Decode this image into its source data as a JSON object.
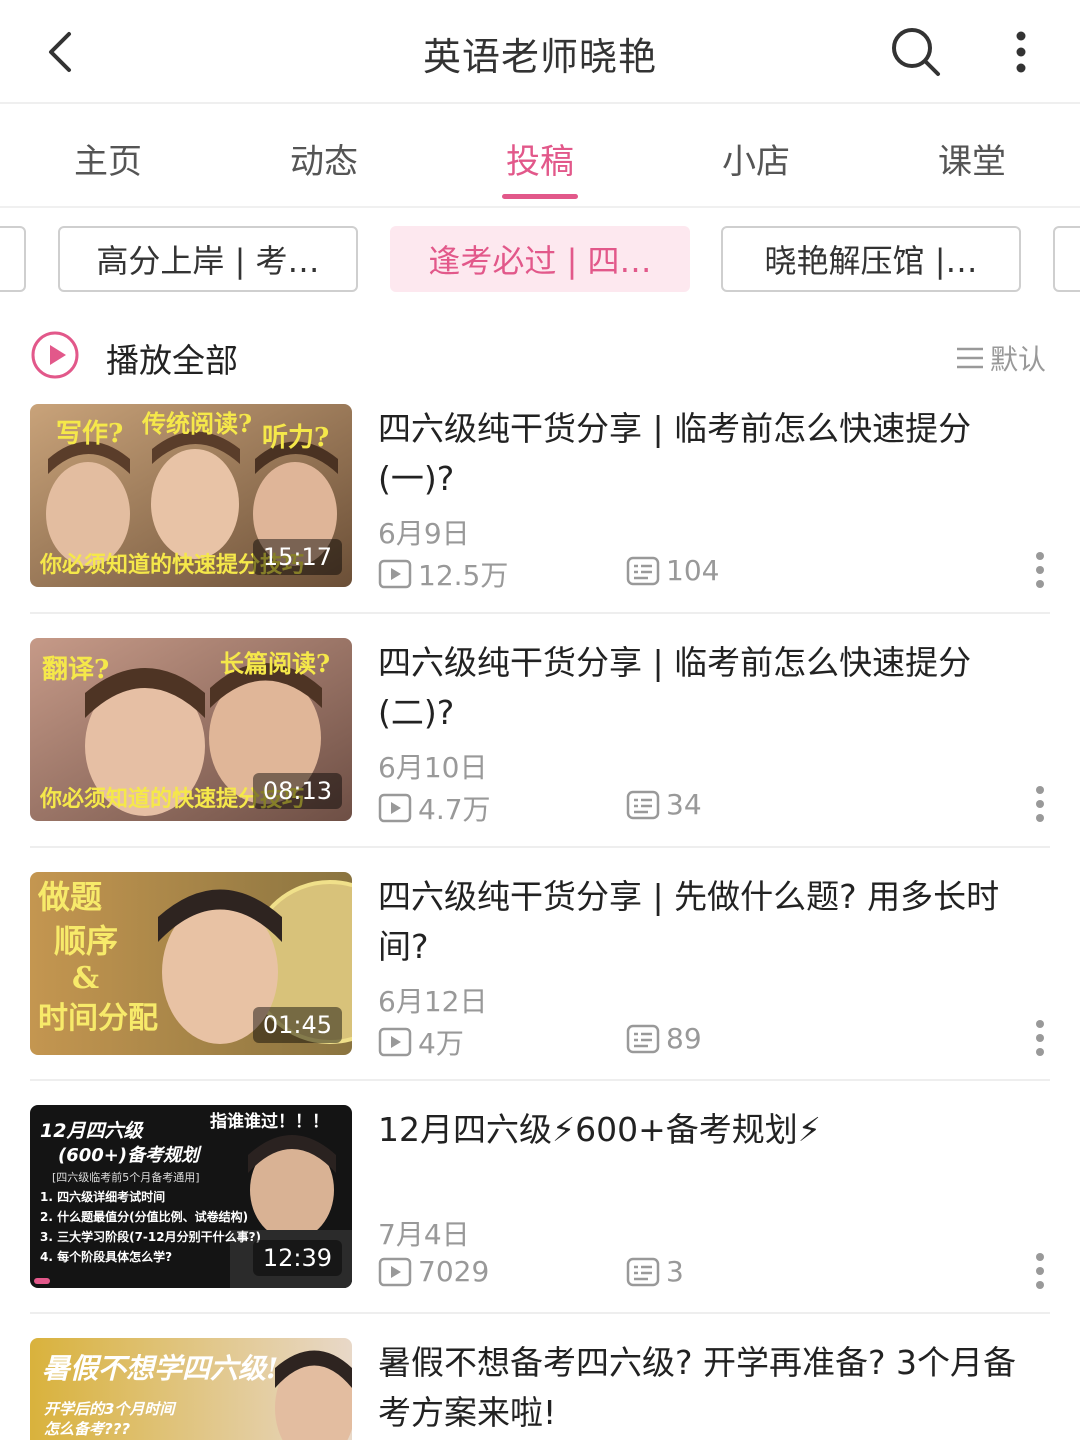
{
  "header": {
    "title": "英语老师晓艳",
    "icons": [
      "back-arrow-icon",
      "search-icon",
      "more-vertical-icon"
    ]
  },
  "tabs": [
    {
      "label": "主页",
      "active": false
    },
    {
      "label": "动态",
      "active": false
    },
    {
      "label": "投稿",
      "active": true
    },
    {
      "label": "小店",
      "active": false
    },
    {
      "label": "课堂",
      "active": false
    }
  ],
  "collections": [
    {
      "label": "高分上岸 | 考…",
      "active": false
    },
    {
      "label": "逢考必过 | 四…",
      "active": true
    },
    {
      "label": "晓艳解压馆 |…",
      "active": false
    }
  ],
  "play_all": {
    "label": "播放全部",
    "sort_label": "默认"
  },
  "colors": {
    "accent": "#e2588a",
    "accent_bg": "#fde8ef",
    "muted": "#999999"
  },
  "videos": [
    {
      "title": "四六级纯干货分享 | 临考前怎么快速提分(一)?",
      "date": "6月9日",
      "views": "12.5万",
      "comments": "104",
      "duration": "15:17",
      "thumb": {
        "bg": [
          "#c9a37a",
          "#8c6b4b"
        ],
        "caption": "你必须知道的快速提分技巧",
        "tags": [
          "写作?",
          "传统阅读?",
          "听力?"
        ]
      }
    },
    {
      "title": "四六级纯干货分享 | 临考前怎么快速提分(二)?",
      "date": "6月10日",
      "views": "4.7万",
      "comments": "34",
      "duration": "08:13",
      "thumb": {
        "bg": [
          "#c69a88",
          "#7a5a4e"
        ],
        "caption": "你必须知道的快速提分技巧",
        "tags": [
          "翻译?",
          "长篇阅读?"
        ]
      }
    },
    {
      "title": "四六级纯干货分享 | 先做什么题? 用多长时间?",
      "date": "6月12日",
      "views": "4万",
      "comments": "89",
      "duration": "01:45",
      "thumb": {
        "bg": [
          "#b88a4a",
          "#6a5a3a"
        ],
        "caption": "",
        "tags": [
          "做题",
          "顺序",
          "&",
          "时间分配"
        ]
      }
    },
    {
      "title": "12月四六级⚡600+备考规划⚡",
      "date": "7月4日",
      "views": "7029",
      "comments": "3",
      "duration": "12:39",
      "thumb": {
        "bg": [
          "#111111",
          "#222222"
        ],
        "caption": "",
        "tags": [
          "12月四六级",
          "(600+)备考规划",
          "指谁谁过！！！"
        ]
      }
    },
    {
      "title": "暑假不想备考四六级? 开学再准备? 3个月备考方案来啦!",
      "date": "",
      "views": "",
      "comments": "",
      "duration": "",
      "thumb": {
        "bg": [
          "#d6b03a",
          "#b48a2a"
        ],
        "caption": "",
        "tags": [
          "暑假不想学四六级!",
          "开学后的3个月时间",
          "怎么备考???"
        ]
      }
    }
  ]
}
